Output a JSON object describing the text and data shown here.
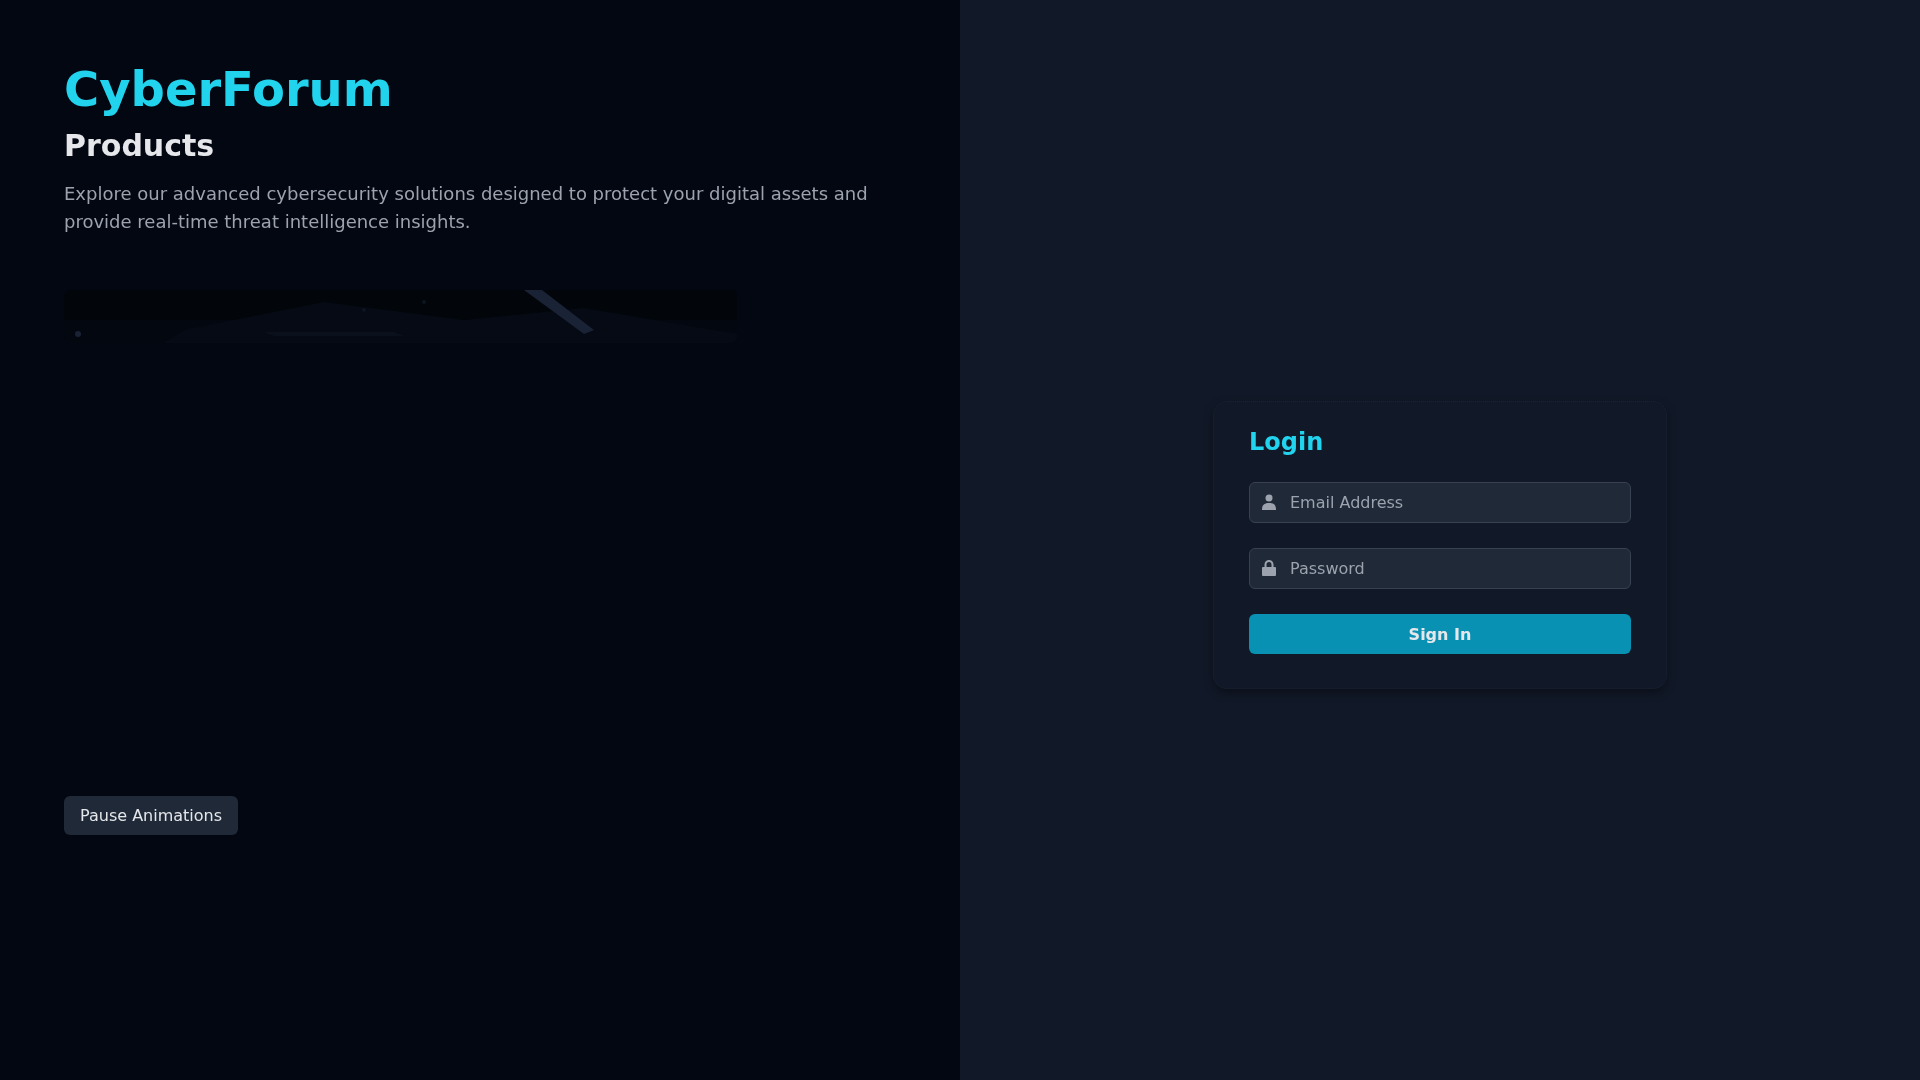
{
  "brand": "CyberForum",
  "section": {
    "title": "Products",
    "description": "Explore our advanced cybersecurity solutions designed to protect your digital assets and provide real-time threat intelligence insights."
  },
  "pause_button": {
    "label": "Pause Animations"
  },
  "login": {
    "title": "Login",
    "fields": [
      {
        "kind": "email",
        "placeholder": "Email Address"
      },
      {
        "kind": "password",
        "placeholder": "Password"
      }
    ],
    "submit": "Sign In"
  }
}
